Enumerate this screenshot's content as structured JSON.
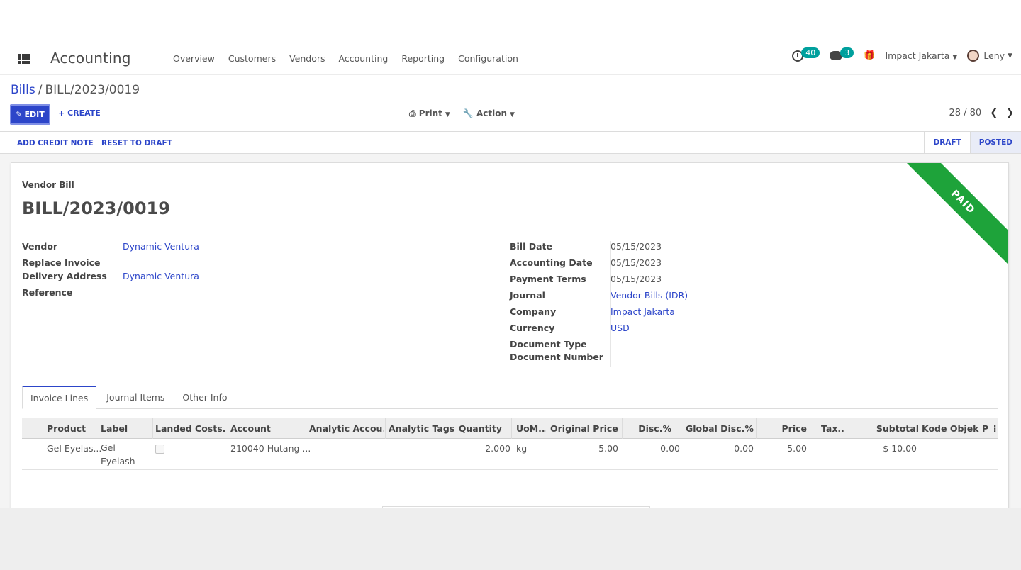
{
  "navbar": {
    "brand": "Accounting",
    "menu": [
      "Overview",
      "Customers",
      "Vendors",
      "Accounting",
      "Reporting",
      "Configuration"
    ],
    "activities_count": "40",
    "messages_count": "3",
    "company": "Impact Jakarta",
    "user": "Leny"
  },
  "breadcrumb": {
    "parent": "Bills",
    "current": "BILL/2023/0019"
  },
  "buttons": {
    "edit": "EDIT",
    "create": "CREATE",
    "print": "Print",
    "action": "Action"
  },
  "pager": {
    "value": "28 / 80"
  },
  "statusbar": {
    "buttons": [
      "ADD CREDIT NOTE",
      "RESET TO DRAFT"
    ],
    "stages": [
      "DRAFT",
      "POSTED"
    ],
    "active_stage": "POSTED"
  },
  "ribbon": "PAID",
  "bill": {
    "type_label": "Vendor Bill",
    "name": "BILL/2023/0019",
    "left_fields": [
      {
        "label": "Vendor",
        "value": "Dynamic Ventura"
      },
      {
        "label": "Replace Invoice",
        "value": ""
      },
      {
        "label": "Delivery Address",
        "value": "Dynamic Ventura"
      },
      {
        "label": "Reference",
        "value": ""
      }
    ],
    "right_fields": [
      {
        "label": "Bill Date",
        "value": "05/15/2023"
      },
      {
        "label": "Accounting Date",
        "value": "05/15/2023"
      },
      {
        "label": "Payment Terms",
        "value": "05/15/2023"
      },
      {
        "label": "Journal",
        "value": "Vendor Bills (IDR)"
      },
      {
        "label": "Company",
        "value": "Impact Jakarta"
      },
      {
        "label": "Currency",
        "value": "USD"
      },
      {
        "label": "Document Type",
        "value": ""
      },
      {
        "label": "Document Number",
        "value": ""
      }
    ]
  },
  "tabs": [
    "Invoice Lines",
    "Journal Items",
    "Other Info"
  ],
  "table": {
    "headers": [
      "Product",
      "Label",
      "Landed Costs...",
      "Account",
      "Analytic Accou...",
      "Analytic Tags",
      "Quantity",
      "UoM...",
      "Original Price",
      "Disc.%",
      "Global Disc.%",
      "Price",
      "Tax...",
      "Subtotal",
      "Kode Objek P..."
    ],
    "rows": [
      {
        "product": "Gel Eyelas...",
        "label": "Gel Eyelash",
        "landed_costs": false,
        "account": "210040 Hutang ...",
        "analytic_account": "",
        "analytic_tags": "",
        "quantity": "2.000",
        "uom": "kg",
        "original_price": "5.00",
        "disc": "0.00",
        "global_disc": "0.00",
        "price": "5.00",
        "tax": "",
        "subtotal": "$ 10.00",
        "kode_objek": ""
      }
    ]
  }
}
